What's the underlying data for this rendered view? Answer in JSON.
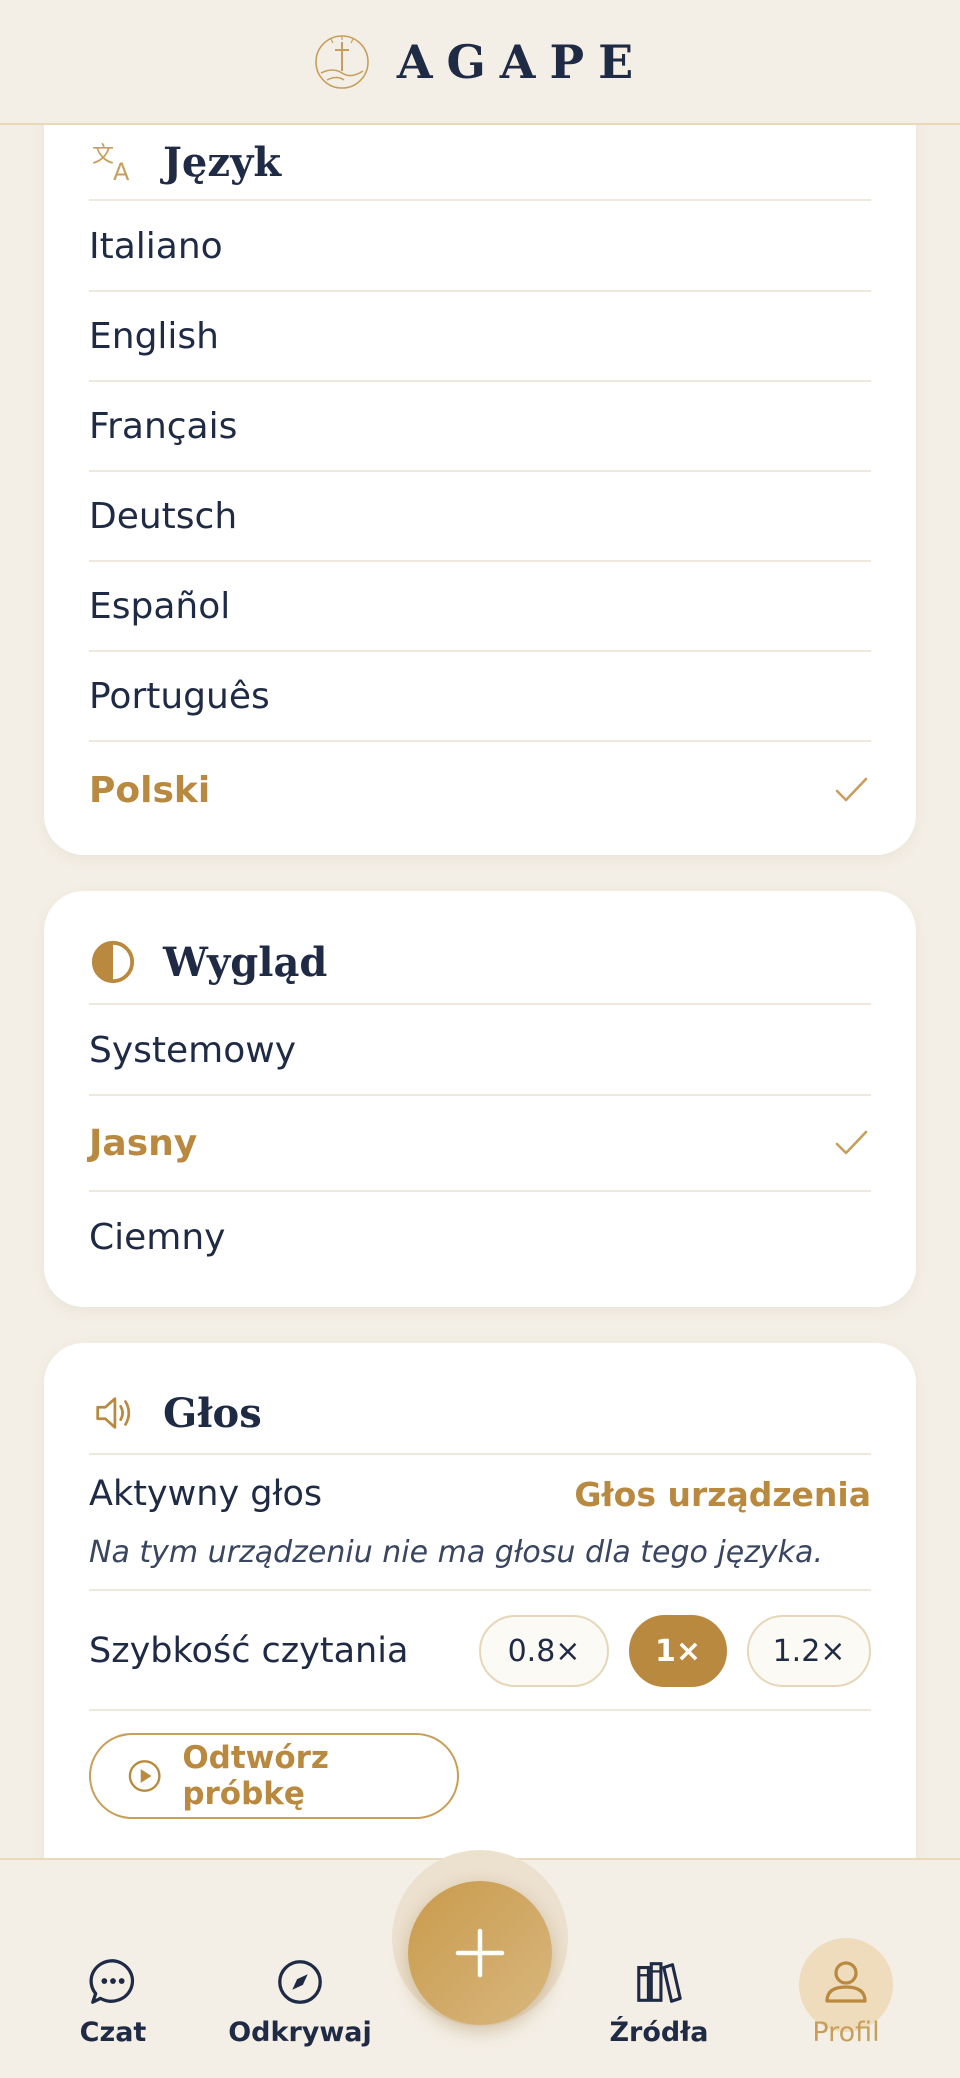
{
  "header": {
    "brand": "AGAPE",
    "logo_icon": "cross-sun-logo"
  },
  "language": {
    "title": "Język",
    "icon": "translate-icon",
    "options": [
      "Italiano",
      "English",
      "Français",
      "Deutsch",
      "Español",
      "Português",
      "Polski"
    ],
    "selected": "Polski"
  },
  "appearance": {
    "title": "Wygląd",
    "icon": "contrast-icon",
    "options": [
      "Systemowy",
      "Jasny",
      "Ciemny"
    ],
    "selected": "Jasny"
  },
  "voice": {
    "title": "Głos",
    "icon": "speaker-icon",
    "active_label": "Aktywny głos",
    "active_value": "Głos urządzenia",
    "note": "Na tym urządzeniu nie ma głosu dla tego języka.",
    "speed_label": "Szybkość czytania",
    "speeds": [
      "0.8×",
      "1×",
      "1.2×"
    ],
    "selected_speed": "1×",
    "play_label": "Odtwórz próbkę"
  },
  "nav": {
    "items": [
      {
        "label": "Czat",
        "icon": "chat-icon"
      },
      {
        "label": "Odkrywaj",
        "icon": "compass-icon"
      },
      {
        "label": "Źródła",
        "icon": "books-icon"
      },
      {
        "label": "Profil",
        "icon": "user-icon"
      }
    ],
    "active": "Profil",
    "fab_icon": "plus-icon"
  },
  "colors": {
    "accent": "#b8893e",
    "text": "#1f2a44",
    "background": "#f4efe6"
  }
}
